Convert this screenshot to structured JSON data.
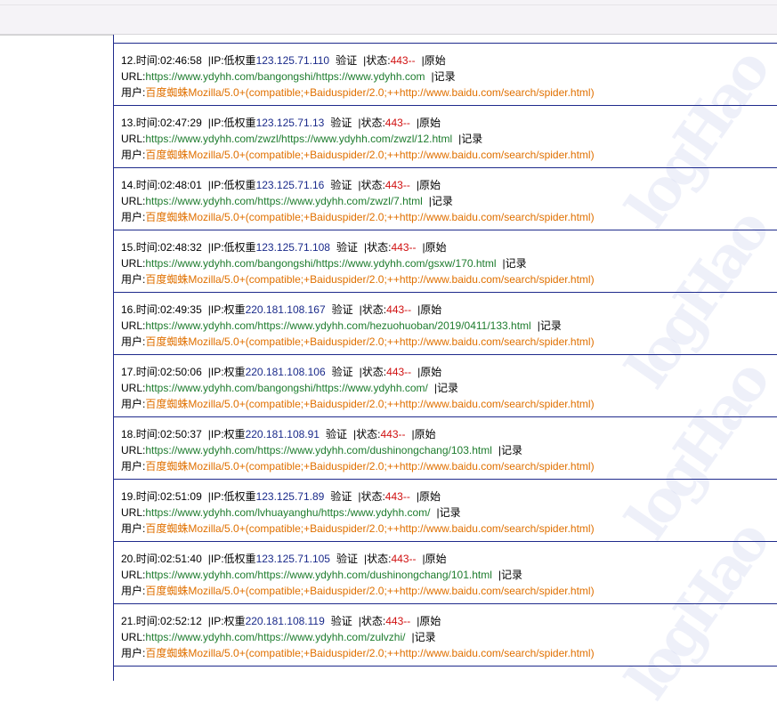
{
  "labels": {
    "time": "时间:",
    "ip": "IP:",
    "verify": "验证",
    "status": "状态:",
    "original": "原始",
    "url": "URL:",
    "record": "记录",
    "user": "用户:"
  },
  "watermark": "logHao",
  "entries": [
    {
      "no": "12.",
      "time": "02:46:58",
      "ip_type": "低权重",
      "ip": "123.125.71.110",
      "status": "443--",
      "url": "https://www.ydyhh.com/bangongshi/https://www.ydyhh.com",
      "ua_name": "百度蜘蛛",
      "ua": "Mozilla/5.0+(compatible;+Baiduspider/2.0;++http://www.baidu.com/search/spider.html)"
    },
    {
      "no": "13.",
      "time": "02:47:29",
      "ip_type": "低权重",
      "ip": "123.125.71.13",
      "status": "443--",
      "url": "https://www.ydyhh.com/zwzl/https://www.ydyhh.com/zwzl/12.html",
      "ua_name": "百度蜘蛛",
      "ua": "Mozilla/5.0+(compatible;+Baiduspider/2.0;++http://www.baidu.com/search/spider.html)"
    },
    {
      "no": "14.",
      "time": "02:48:01",
      "ip_type": "低权重",
      "ip": "123.125.71.16",
      "status": "443--",
      "url": "https://www.ydyhh.com/https://www.ydyhh.com/zwzl/7.html",
      "ua_name": "百度蜘蛛",
      "ua": "Mozilla/5.0+(compatible;+Baiduspider/2.0;++http://www.baidu.com/search/spider.html)"
    },
    {
      "no": "15.",
      "time": "02:48:32",
      "ip_type": "低权重",
      "ip": "123.125.71.108",
      "status": "443--",
      "url": "https://www.ydyhh.com/bangongshi/https://www.ydyhh.com/gsxw/170.html",
      "ua_name": "百度蜘蛛",
      "ua": "Mozilla/5.0+(compatible;+Baiduspider/2.0;++http://www.baidu.com/search/spider.html)"
    },
    {
      "no": "16.",
      "time": "02:49:35",
      "ip_type": "权重",
      "ip": "220.181.108.167",
      "status": "443--",
      "url": "https://www.ydyhh.com/https://www.ydyhh.com/hezuohuoban/2019/0411/133.html",
      "ua_name": "百度蜘蛛",
      "ua": "Mozilla/5.0+(compatible;+Baiduspider/2.0;++http://www.baidu.com/search/spider.html)"
    },
    {
      "no": "17.",
      "time": "02:50:06",
      "ip_type": "权重",
      "ip": "220.181.108.106",
      "status": "443--",
      "url": "https://www.ydyhh.com/bangongshi/https://www.ydyhh.com/",
      "ua_name": "百度蜘蛛",
      "ua": "Mozilla/5.0+(compatible;+Baiduspider/2.0;++http://www.baidu.com/search/spider.html)"
    },
    {
      "no": "18.",
      "time": "02:50:37",
      "ip_type": "权重",
      "ip": "220.181.108.91",
      "status": "443--",
      "url": "https://www.ydyhh.com/https://www.ydyhh.com/dushinongchang/103.html",
      "ua_name": "百度蜘蛛",
      "ua": "Mozilla/5.0+(compatible;+Baiduspider/2.0;++http://www.baidu.com/search/spider.html)"
    },
    {
      "no": "19.",
      "time": "02:51:09",
      "ip_type": "低权重",
      "ip": "123.125.71.89",
      "status": "443--",
      "url": "https://www.ydyhh.com/lvhuayanghu/https:/www.ydyhh.com/",
      "ua_name": "百度蜘蛛",
      "ua": "Mozilla/5.0+(compatible;+Baiduspider/2.0;++http://www.baidu.com/search/spider.html)"
    },
    {
      "no": "20.",
      "time": "02:51:40",
      "ip_type": "低权重",
      "ip": "123.125.71.105",
      "status": "443--",
      "url": "https://www.ydyhh.com/https://www.ydyhh.com/dushinongchang/101.html",
      "ua_name": "百度蜘蛛",
      "ua": "Mozilla/5.0+(compatible;+Baiduspider/2.0;++http://www.baidu.com/search/spider.html)"
    },
    {
      "no": "21.",
      "time": "02:52:12",
      "ip_type": "权重",
      "ip": "220.181.108.119",
      "status": "443--",
      "url": "https://www.ydyhh.com/https://www.ydyhh.com/zulvzhi/",
      "ua_name": "百度蜘蛛",
      "ua": "Mozilla/5.0+(compatible;+Baiduspider/2.0;++http://www.baidu.com/search/spider.html)"
    }
  ]
}
